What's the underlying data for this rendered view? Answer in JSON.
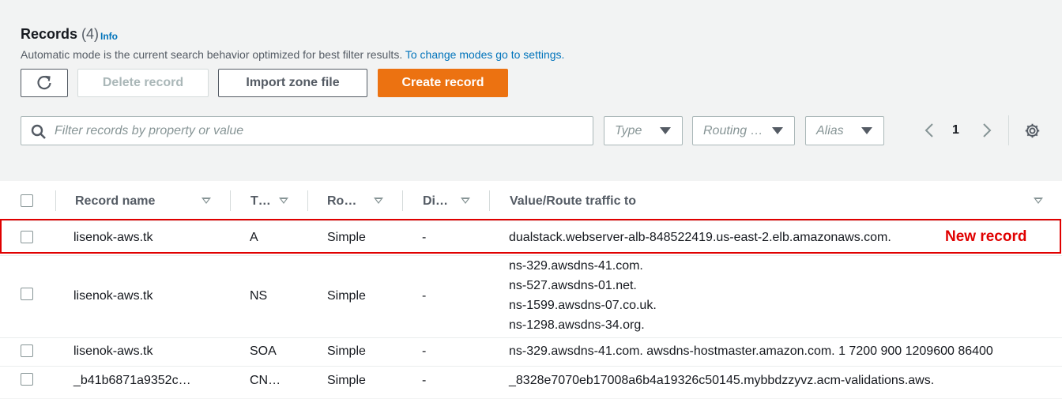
{
  "header": {
    "title": "Records",
    "count": "(4)",
    "info": "Info",
    "description": "Automatic mode is the current search behavior optimized for best filter results.",
    "description_link": "To change modes go to settings."
  },
  "actions": {
    "delete": "Delete record",
    "import": "Import zone file",
    "create": "Create record"
  },
  "filters": {
    "search_placeholder": "Filter records by property or value",
    "type": "Type",
    "routing": "Routing …",
    "alias": "Alias"
  },
  "pagination": {
    "page": "1"
  },
  "columns": [
    "Record name",
    "T…",
    "Ro…",
    "Di…",
    "Value/Route traffic to"
  ],
  "rows": [
    {
      "name": "lisenok-aws.tk",
      "type": "A",
      "routing": "Simple",
      "diff": "-",
      "values": [
        "dualstack.webserver-alb-848522419.us-east-2.elb.amazonaws.com."
      ]
    },
    {
      "name": "lisenok-aws.tk",
      "type": "NS",
      "routing": "Simple",
      "diff": "-",
      "values": [
        "ns-329.awsdns-41.com.",
        "ns-527.awsdns-01.net.",
        "ns-1599.awsdns-07.co.uk.",
        "ns-1298.awsdns-34.org."
      ]
    },
    {
      "name": "lisenok-aws.tk",
      "type": "SOA",
      "routing": "Simple",
      "diff": "-",
      "values": [
        "ns-329.awsdns-41.com. awsdns-hostmaster.amazon.com. 1 7200 900 1209600 86400"
      ]
    },
    {
      "name": "_b41b6871a9352c…",
      "type": "CN…",
      "routing": "Simple",
      "diff": "-",
      "values": [
        "_8328e7070eb17008a6b4a19326c50145.mybbdzzyvz.acm-validations.aws."
      ]
    }
  ],
  "annotation": "New record",
  "colors": {
    "primary": "#ec7211",
    "link": "#0073bb",
    "highlight": "#e00000"
  }
}
